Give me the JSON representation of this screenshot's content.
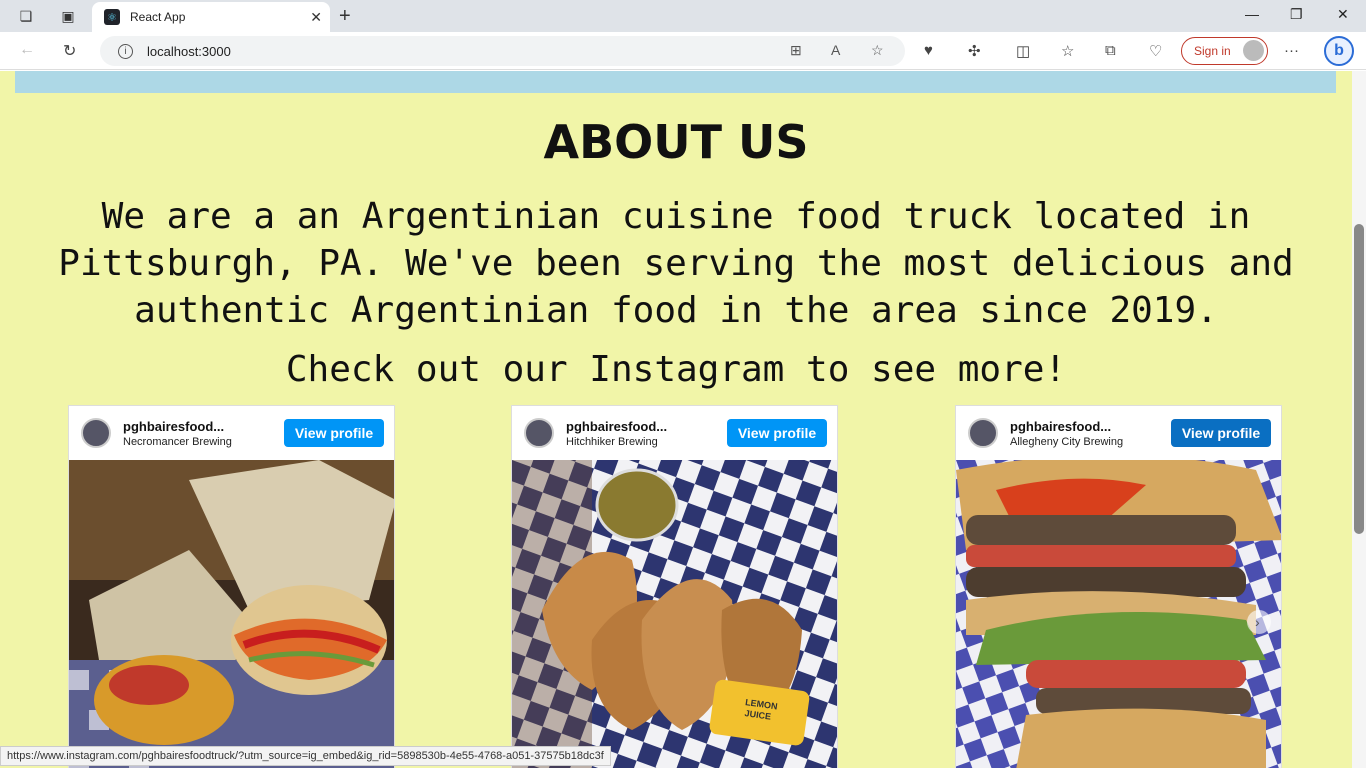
{
  "browser": {
    "tab_title": "React App",
    "url": "localhost:3000",
    "signin_label": "Sign in",
    "status_url": "https://www.instagram.com/pghbairesfoodtruck/?utm_source=ig_embed&ig_rid=5898530b-4e55-4768-a051-37575b18dc3f"
  },
  "page": {
    "title": "ABOUT US",
    "description": "We are a an Argentinian cuisine food truck located in Pittsburgh, PA. We've been serving the most delicious and authentic Argentinian food in the area since 2019.",
    "cta": "Check out our Instagram to see more!"
  },
  "instagram": {
    "posts": [
      {
        "username": "pghbairesfood...",
        "location": "Necromancer Brewing",
        "button": "View profile",
        "photo": "fries-and-sandwich"
      },
      {
        "username": "pghbairesfood...",
        "location": "Hitchhiker Brewing",
        "button": "View profile",
        "photo": "empanadas"
      },
      {
        "username": "pghbairesfood...",
        "location": "Allegheny City Brewing",
        "button": "View profile",
        "photo": "burger"
      }
    ]
  },
  "colors": {
    "page_bg": "#f1f5a8",
    "top_bar": "#add8e6",
    "ig_blue": "#0095f6"
  }
}
